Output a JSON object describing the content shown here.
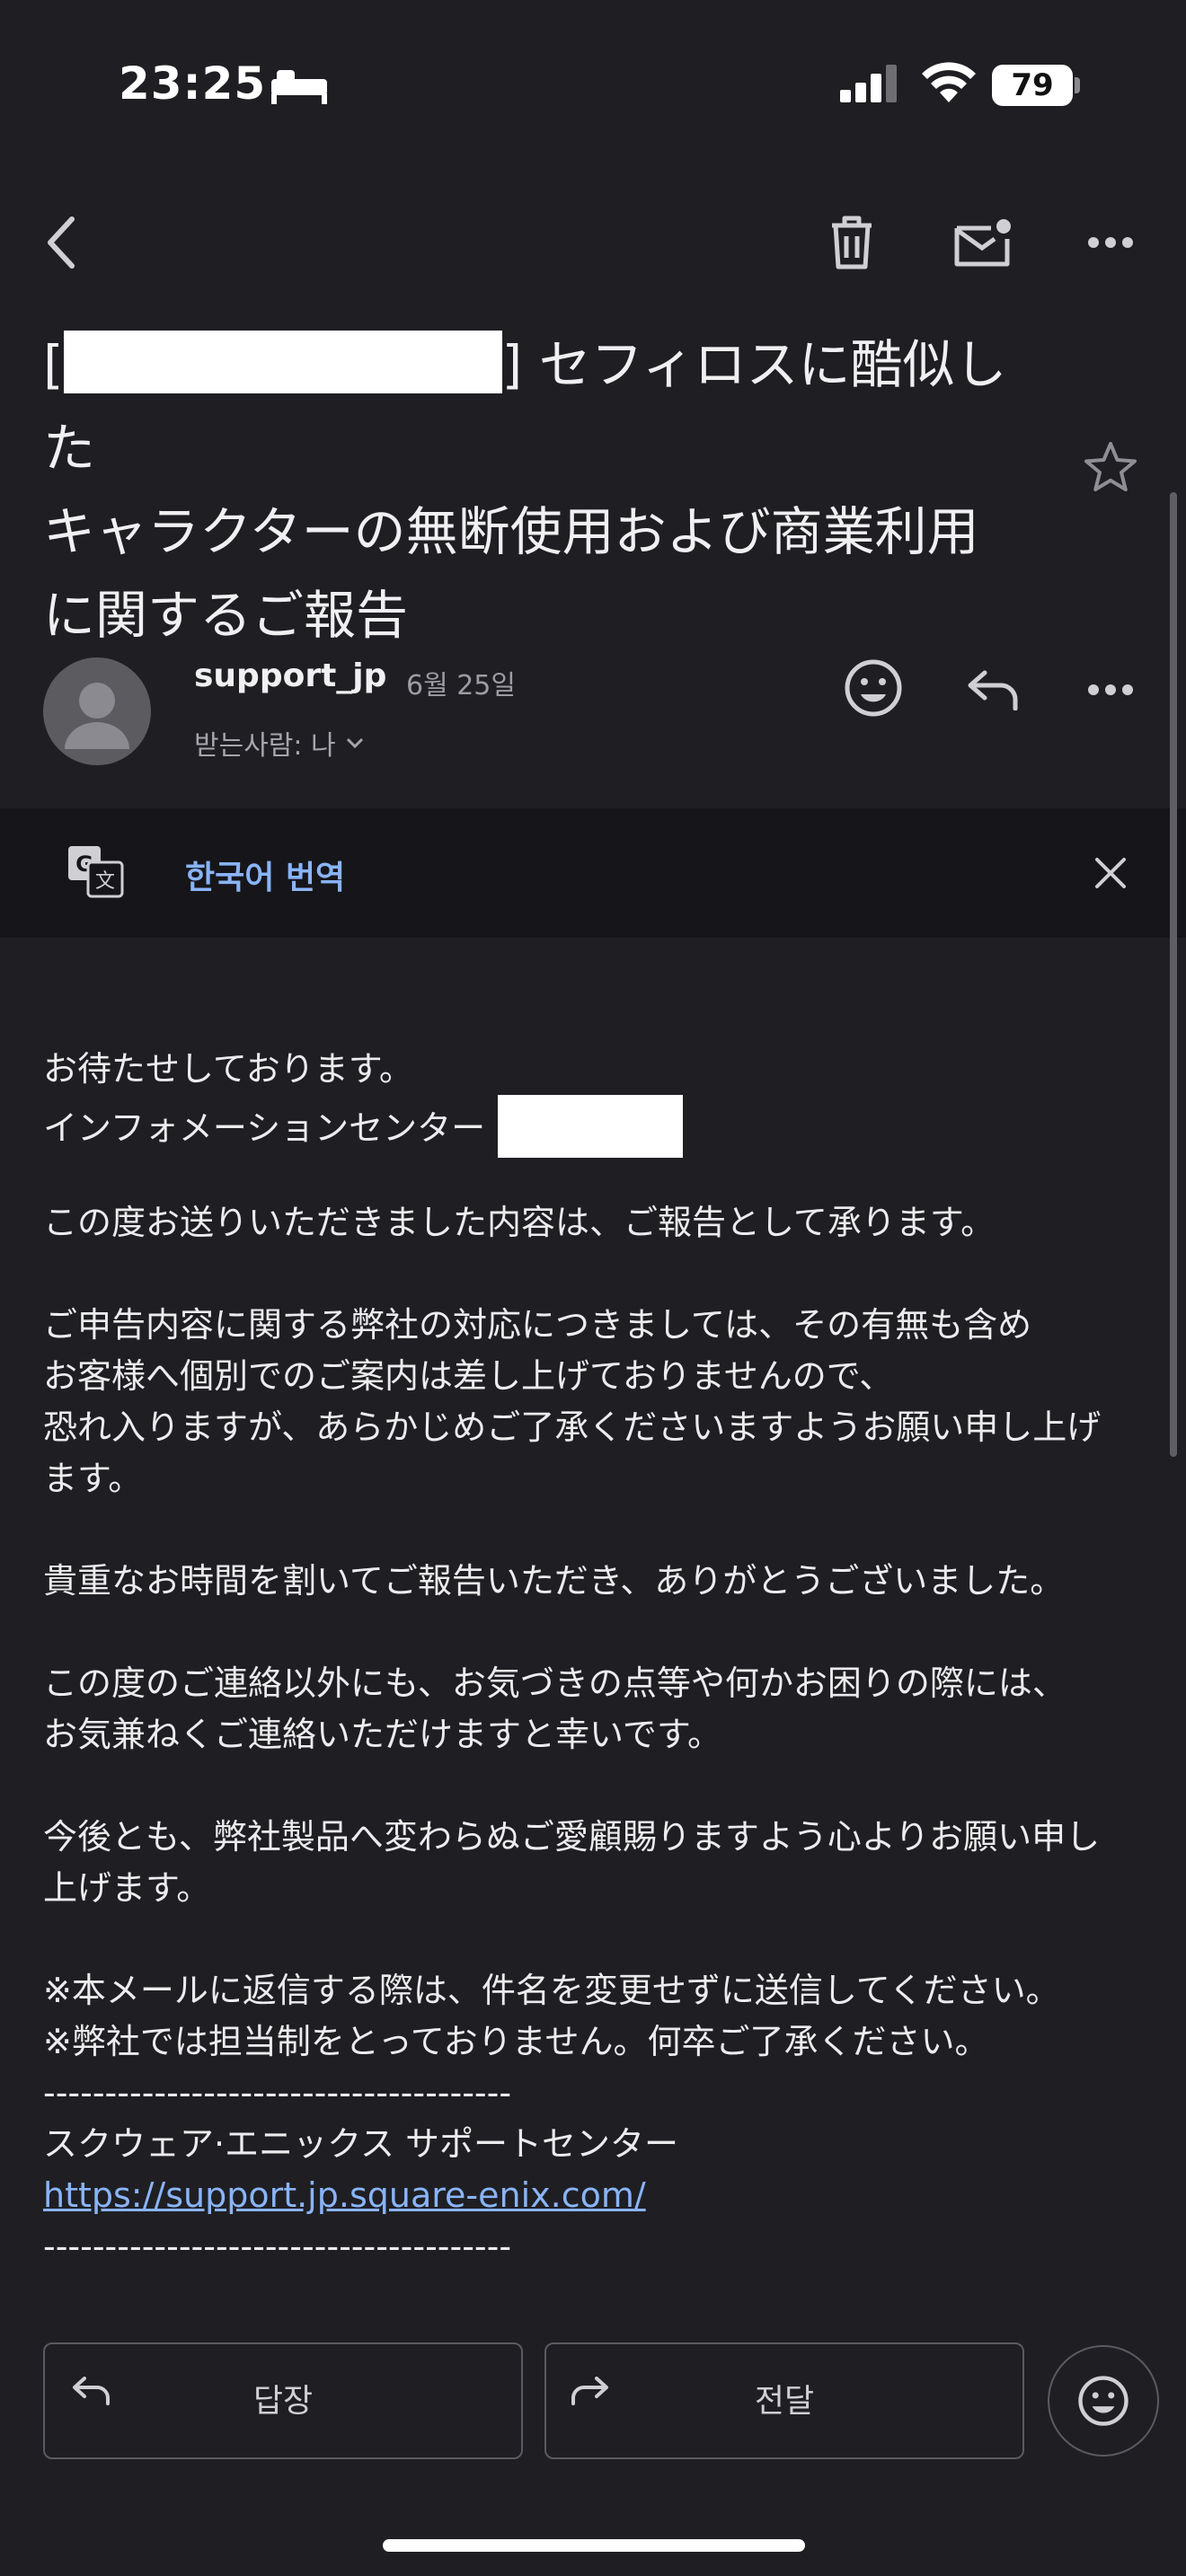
{
  "status_bar": {
    "time": "23:25",
    "battery": "79"
  },
  "email": {
    "subject_lines": [
      "] セフィロスに酷似した",
      "キャラクターの無断使用および商業利用",
      "に関するご報告"
    ],
    "subject_bracket_open": "[",
    "sender": "support_jp",
    "date": "6월 25일",
    "recipient": "받는사람: 나",
    "translate_label": "한국어 번역",
    "body": {
      "l1": "お待たせしております。",
      "l2": "インフォメーションセンター",
      "l3": "この度お送りいただきました内容は、ご報告として承ります。",
      "l4": "ご申告内容に関する弊社の対応につきましては、その有無も含め",
      "l5": "お客様へ個別でのご案内は差し上げておりませんので、",
      "l6": "恐れ入りますが、あらかじめご了承くださいますようお願い申し上げ",
      "l7": "ます。",
      "l8": "貴重なお時間を割いてご報告いただき、ありがとうございました。",
      "l9": "この度のご連絡以外にも、お気づきの点等や何かお困りの際には、",
      "l10": "お気兼ねくご連絡いただけますと幸いです。",
      "l11": "今後とも、弊社製品へ変わらぬご愛顧賜りますよう心よりお願い申し",
      "l12": "上げます。",
      "l13": "※本メールに返信する際は、件名を変更せずに送信してください。",
      "l14": "※弊社では担当制をとっておりません。何卒ご了承ください。",
      "divider": "--------------------------------------",
      "signature": "スクウェア·エニックス サポートセンター",
      "link": "https://support.jp.square-enix.com/"
    }
  },
  "actions": {
    "reply": "답장",
    "forward": "전달"
  }
}
